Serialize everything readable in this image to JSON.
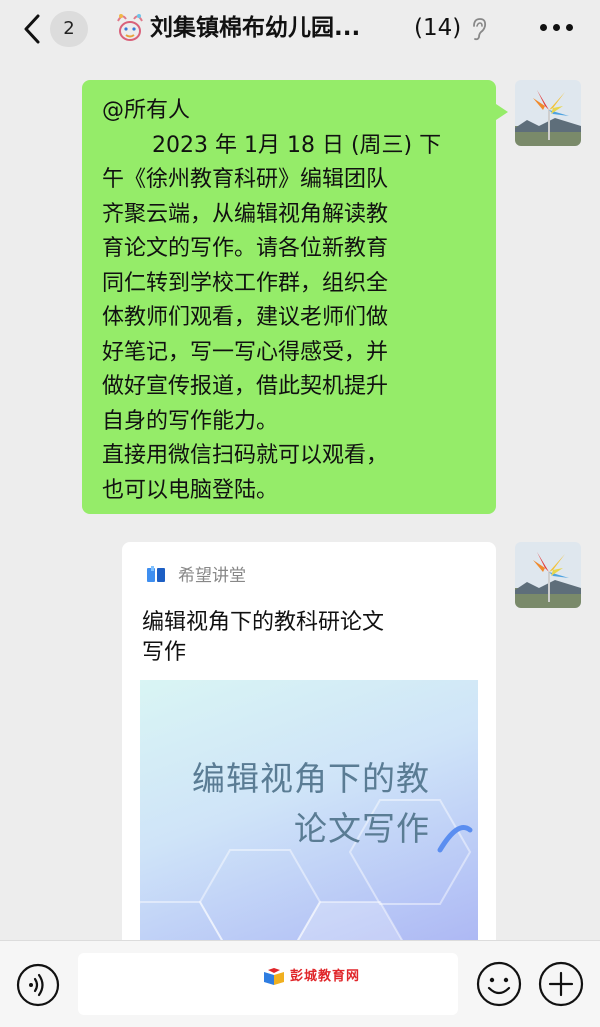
{
  "header": {
    "unread_count": "2",
    "title": "刘集镇棉布幼儿园...",
    "member_count": "(14)",
    "back_icon": "chevron-left-icon",
    "ear_icon": "ear-icon",
    "more_icon": "more-dots-icon"
  },
  "messages": {
    "text_bubble": {
      "lines": [
        "@所有人",
        "2023 年 1月 18 日 (周三) 下",
        "午《徐州教育科研》编辑团队",
        "齐聚云端，从编辑视角解读教",
        "育论文的写作。请各位新教育",
        "同仁转到学校工作群，组织全",
        "体教师们观看，建议老师们做",
        "好笔记，写一写心得感受，并",
        "做好宣传报道，借此契机提升",
        "自身的写作能力。",
        "直接用微信扫码就可以观看，",
        "也可以电脑登陆。"
      ],
      "color": "#95ec69"
    },
    "link_card": {
      "source": "希望讲堂",
      "title_lines": [
        "编辑视角下的教科研论文",
        "写作"
      ],
      "image_text_line1": "编辑视角下的教",
      "image_text_line2": "论文写作"
    }
  },
  "input_bar": {
    "voice_icon": "voice-icon",
    "emoji_icon": "emoji-icon",
    "plus_icon": "plus-icon"
  },
  "watermark": {
    "text": "彭城教育网"
  }
}
